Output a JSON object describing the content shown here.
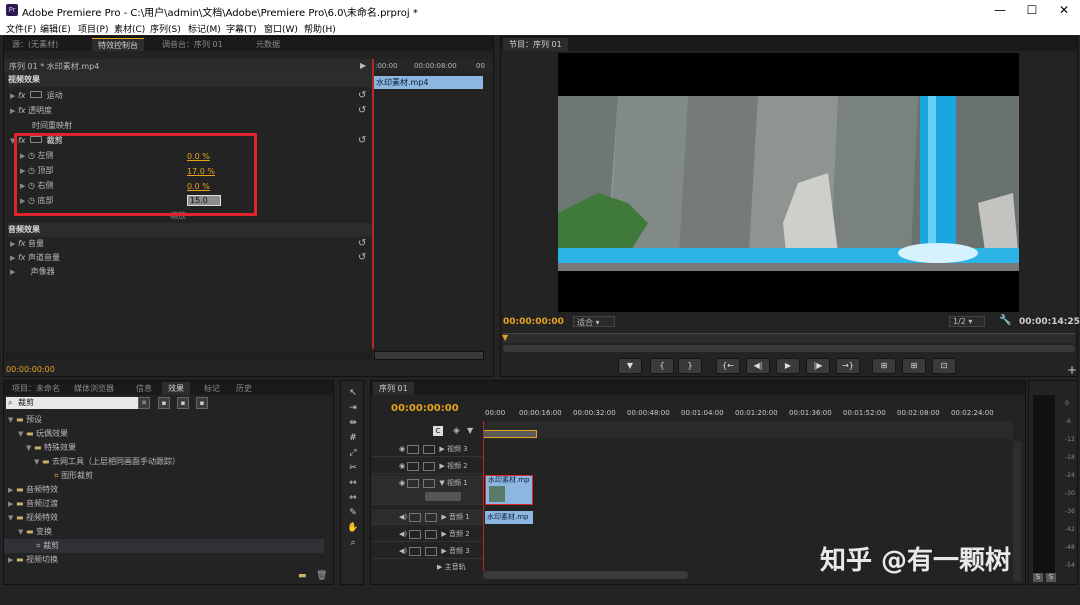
{
  "window": {
    "title": "Adobe Premiere Pro - C:\\用户\\admin\\文档\\Adobe\\Premiere Pro\\6.0\\未命名.prproj *",
    "logo": "Pr",
    "min": "—",
    "max": "☐",
    "close": "✕"
  },
  "menu": [
    "文件(F)",
    "编辑(E)",
    "项目(P)",
    "素材(C)",
    "序列(S)",
    "标记(M)",
    "字幕(T)",
    "窗口(W)",
    "帮助(H)"
  ],
  "effect_controls": {
    "tabs": [
      "源：(无素材)",
      "特效控制台",
      "调音台：序列 01",
      "元数据"
    ],
    "header": "序列 01 * 水印素材.mp4",
    "time_start": ":00:00",
    "time_mid": "00:00:08:00",
    "time_end": "00",
    "clip_label": "水印素材.mp4",
    "video_effects": "视频效果",
    "motion": "运动",
    "opacity": "透明度",
    "time_remap": "时间重映射",
    "crop": "裁剪",
    "crop_params": [
      {
        "label": "左侧",
        "value": "0.0 %"
      },
      {
        "label": "顶部",
        "value": "17.0 %"
      },
      {
        "label": "右侧",
        "value": "0.0 %"
      },
      {
        "label": "底部",
        "value": "15.0"
      }
    ],
    "zoom_label": "缩放",
    "audio_effects": "音频效果",
    "volume": "音量",
    "channel_volume": "声道音量",
    "panner": "声像器",
    "timecode": "00:00:00:00"
  },
  "program": {
    "tab": "节目：序列 01",
    "timecode_left": "00:00:00:00",
    "fit": "适合",
    "ratio": "1/2",
    "timecode_right": "00:00:14:25"
  },
  "transport": [
    "▼",
    "{",
    "}",
    "{←",
    "◀|",
    "▶",
    "|▶",
    "→}",
    "⊞",
    "⊞",
    "⊡"
  ],
  "project_panel": {
    "tabs": [
      "项目：未命名",
      "媒体浏览器",
      "信息",
      "效果",
      "标记",
      "历史"
    ],
    "search": "裁剪",
    "tree": [
      {
        "indent": 0,
        "label": "预设"
      },
      {
        "indent": 1,
        "label": "玩偶效果"
      },
      {
        "indent": 2,
        "label": "特殊效果"
      },
      {
        "indent": 3,
        "label": "去网工具（上层相同画面手动跟踪）"
      },
      {
        "indent": 4,
        "label": "图形裁剪"
      },
      {
        "indent": 0,
        "label": "音频特效"
      },
      {
        "indent": 0,
        "label": "音频过渡"
      },
      {
        "indent": 0,
        "label": "视频特效"
      },
      {
        "indent": 1,
        "label": "变换"
      },
      {
        "indent": 2,
        "label": "裁剪"
      },
      {
        "indent": 0,
        "label": "视频切换"
      }
    ]
  },
  "timeline": {
    "tab": "序列 01",
    "timecode": "00:00:00:00",
    "ruler": [
      "00:00",
      "00:00:16:00",
      "00:00:32:00",
      "00:00:48:00",
      "00:01:04:00",
      "00:01:20:00",
      "00:01:36:00",
      "00:01:52:00",
      "00:02:08:00",
      "00:02:24:00"
    ],
    "tracks": [
      "视频 3",
      "视频 2",
      "视频 1",
      "音频 1",
      "音频 2",
      "音频 3",
      "主音轨"
    ],
    "video_clip": "水印素材.mp",
    "audio_clip": "水印素材.mp"
  },
  "audio_meter": {
    "labels": [
      "0",
      "-6",
      "-12",
      "-18",
      "-24",
      "-30",
      "-36",
      "-42",
      "-48",
      "-54"
    ],
    "solo": [
      "S",
      "S"
    ]
  },
  "watermark": "知乎 @有一颗树",
  "colors": {
    "accent_orange": "#e6a41c",
    "highlight_red": "#e0242b",
    "clip_blue": "#8db6e0",
    "water_blue": "#1aa7e0"
  }
}
